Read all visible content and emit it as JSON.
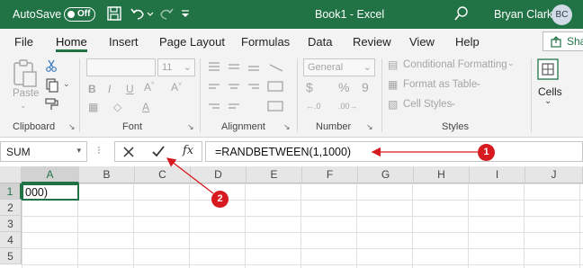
{
  "titlebar": {
    "autosave_label": "AutoSave",
    "autosave_state": "Off",
    "document_title": "Book1  -  Excel",
    "user_name": "Bryan Clark",
    "user_initials": "BC"
  },
  "tabs": [
    "File",
    "Home",
    "Insert",
    "Page Layout",
    "Formulas",
    "Data",
    "Review",
    "View",
    "Help"
  ],
  "share_label": "Shar",
  "ribbon": {
    "clipboard": {
      "paste": "Paste",
      "label": "Clipboard"
    },
    "font": {
      "size": "11",
      "bold": "B",
      "italic": "I",
      "underline": "U",
      "label": "Font"
    },
    "alignment": {
      "label": "Alignment"
    },
    "number": {
      "format": "General",
      "currency": "$",
      "percent": "%",
      "comma": "9",
      "label": "Number"
    },
    "styles": {
      "conditional": "Conditional Formatting",
      "format_table": "Format as Table",
      "cell_styles": "Cell Styles",
      "label": "Styles"
    },
    "cells": {
      "label": "Cells"
    }
  },
  "formula_bar": {
    "name_box": "SUM",
    "fx_label": "fx",
    "formula": "=RANDBETWEEN(1,1000)"
  },
  "grid": {
    "columns": [
      "A",
      "B",
      "C",
      "D",
      "E",
      "F",
      "G",
      "H",
      "I",
      "J"
    ],
    "rows": [
      "1",
      "2",
      "3",
      "4",
      "5"
    ],
    "active_cell_text": "000)"
  },
  "annotations": [
    "1",
    "2"
  ],
  "colors": {
    "accent": "#217346",
    "annotation": "#d71920"
  }
}
